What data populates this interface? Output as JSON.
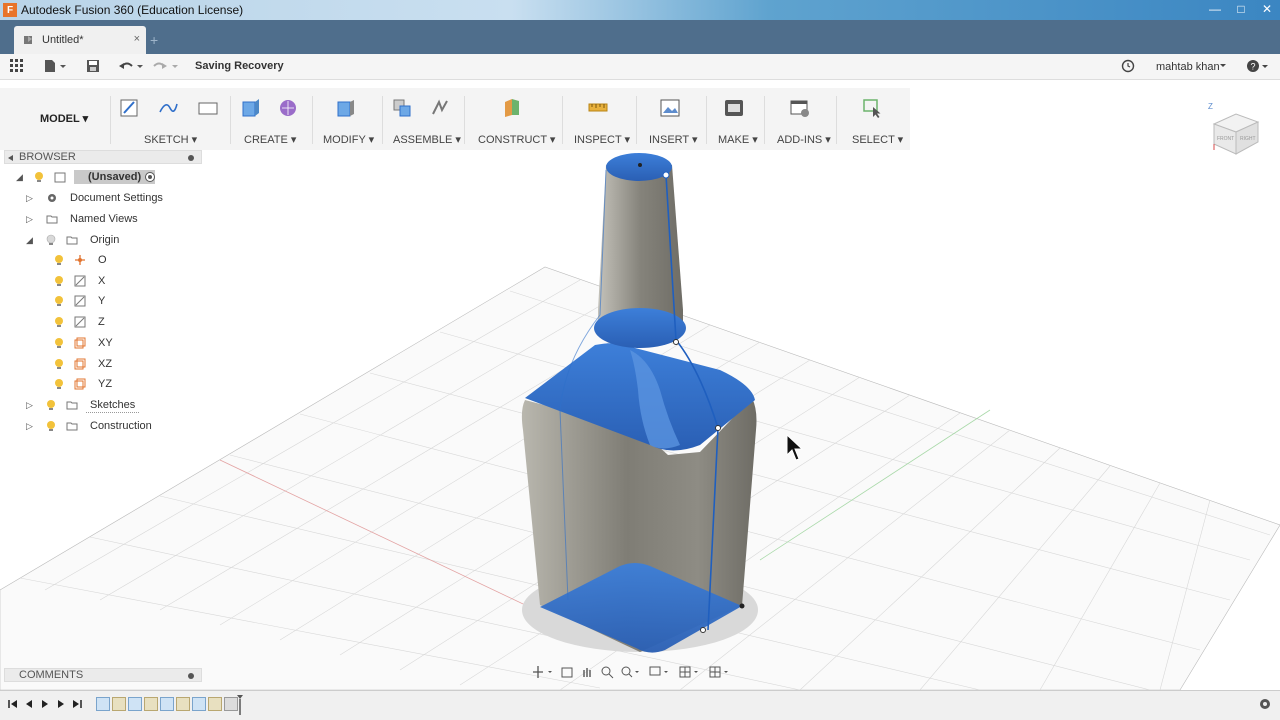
{
  "window": {
    "title": "Autodesk Fusion 360 (Education License)",
    "app_icon_letter": "F",
    "controls": [
      "minimize-icon",
      "maximize-icon",
      "close-icon"
    ]
  },
  "tabs": {
    "active_label": "Untitled*",
    "close_glyph": "×",
    "new_glyph": "+"
  },
  "quick_access": {
    "status": "Saving Recovery",
    "user": "mahtab khan"
  },
  "toolbar": {
    "workspace": "MODEL",
    "groups": [
      "SKETCH",
      "CREATE",
      "MODIFY",
      "ASSEMBLE",
      "CONSTRUCT",
      "INSPECT",
      "INSERT",
      "MAKE",
      "ADD-INS",
      "SELECT"
    ]
  },
  "browser": {
    "title": "BROWSER",
    "root": "(Unsaved)",
    "items": {
      "document_settings": "Document Settings",
      "named_views": "Named Views",
      "origin": "Origin",
      "origin_o": "O",
      "origin_x": "X",
      "origin_y": "Y",
      "origin_z": "Z",
      "origin_xy": "XY",
      "origin_xz": "XZ",
      "origin_yz": "YZ",
      "sketches": "Sketches",
      "construction": "Construction"
    }
  },
  "comments": {
    "title": "COMMENTS"
  },
  "colors": {
    "accent": "#2f6fca",
    "body": "#8c8a82",
    "tab_strip": "#4f6e8c"
  }
}
